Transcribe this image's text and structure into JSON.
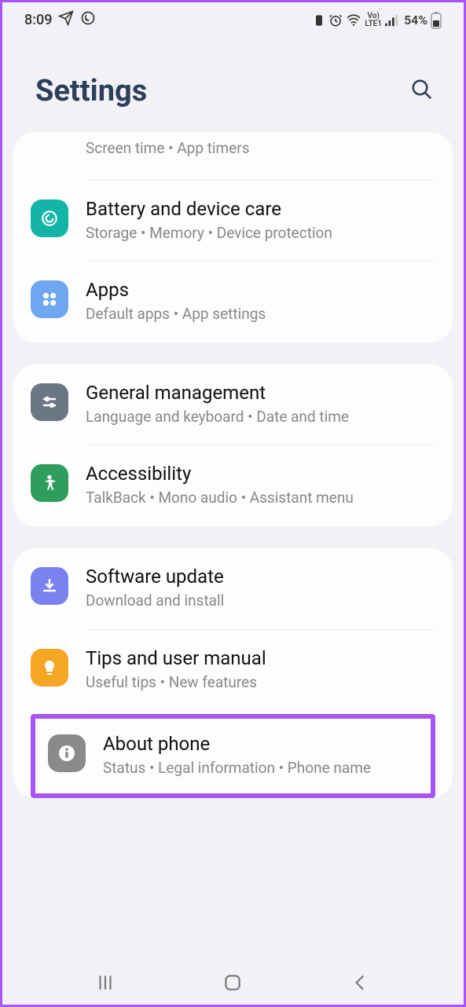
{
  "status": {
    "time": "8:09",
    "battery_pct": "54%",
    "lte": "LTE1",
    "vo": "Vo)"
  },
  "header": {
    "title": "Settings"
  },
  "group1": {
    "digital": {
      "sub": "Screen time  •  App timers"
    },
    "battery": {
      "title": "Battery and device care",
      "sub": "Storage  •  Memory  •  Device protection"
    },
    "apps": {
      "title": "Apps",
      "sub": "Default apps  •  App settings"
    }
  },
  "group2": {
    "general": {
      "title": "General management",
      "sub": "Language and keyboard  •  Date and time"
    },
    "accessibility": {
      "title": "Accessibility",
      "sub": "TalkBack  •  Mono audio  •  Assistant menu"
    }
  },
  "group3": {
    "software": {
      "title": "Software update",
      "sub": "Download and install"
    },
    "tips": {
      "title": "Tips and user manual",
      "sub": "Useful tips  •  New features"
    },
    "about": {
      "title": "About phone",
      "sub": "Status  •  Legal information  •  Phone name"
    }
  }
}
